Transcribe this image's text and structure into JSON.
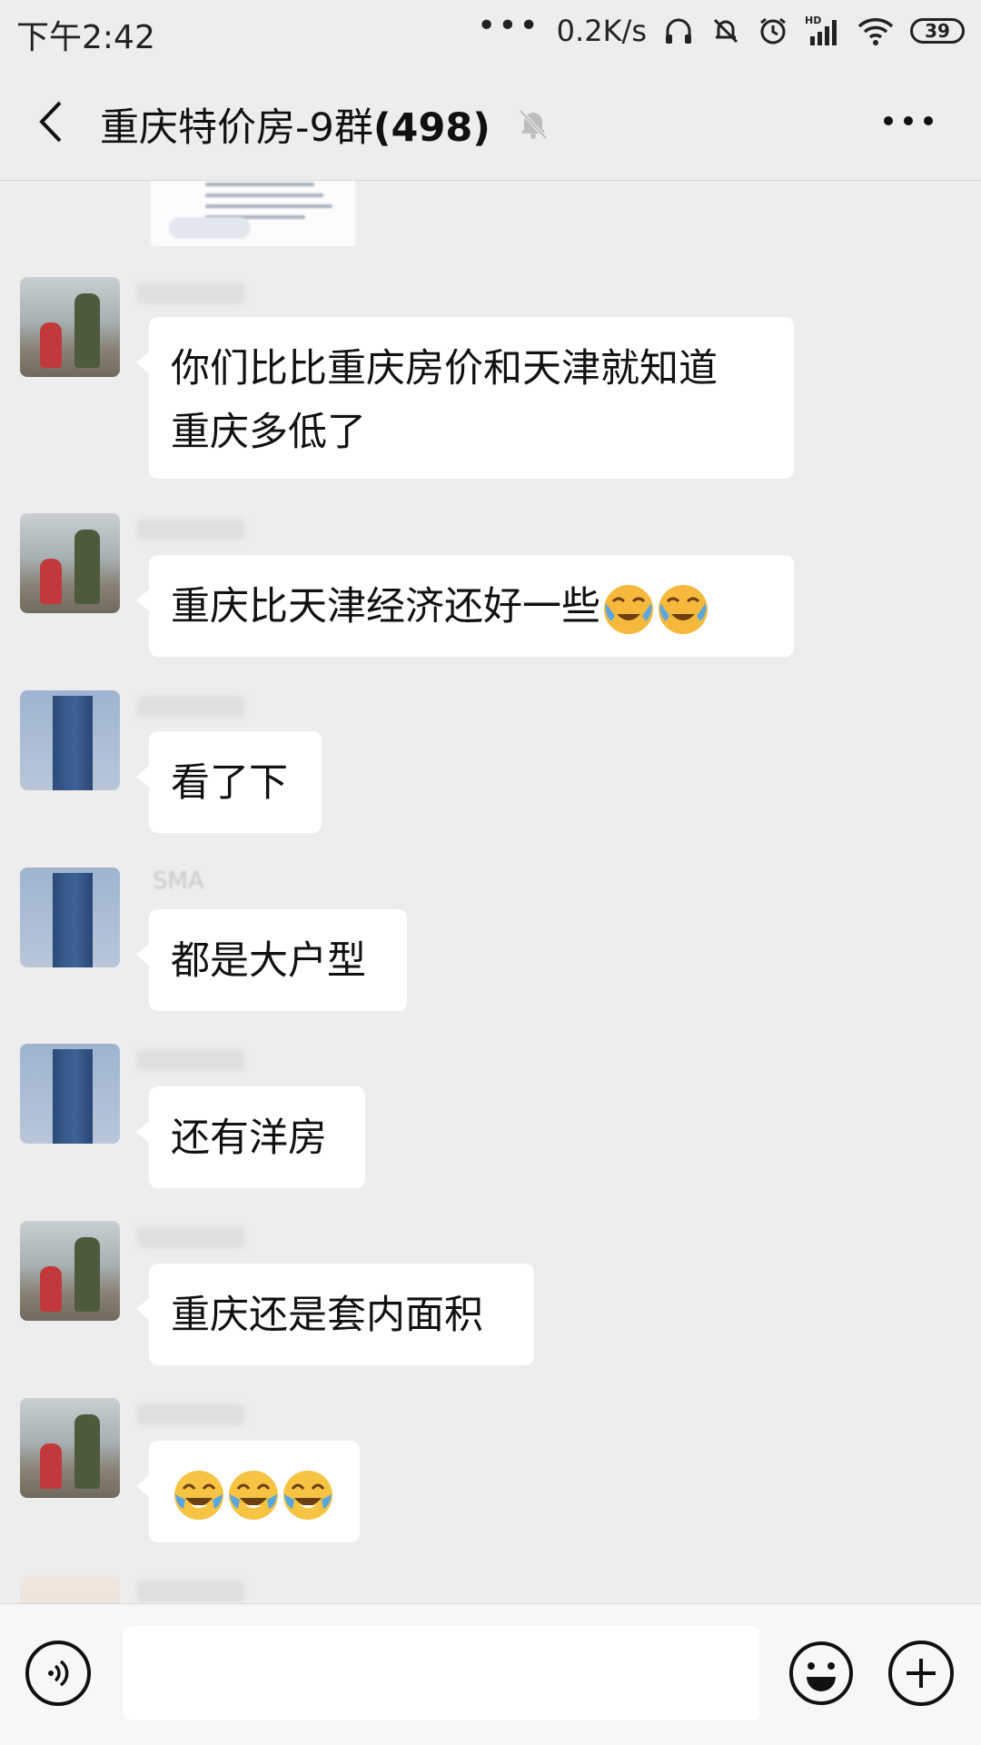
{
  "status_bar": {
    "time": "下午2:42",
    "dots": "•••",
    "network_speed": "0.2K/s",
    "signal_label": "HD",
    "battery": "39",
    "icons": [
      "headphones-icon",
      "mute-icon",
      "alarm-icon",
      "signal-icon",
      "wifi-icon",
      "battery-icon"
    ]
  },
  "header": {
    "title": "重庆特价房-9群",
    "member_count": "(498)",
    "icons": [
      "back-icon",
      "mute-bell-icon",
      "more-icon"
    ]
  },
  "messages": [
    {
      "avatar": "people",
      "nickname": "",
      "text_lines": [
        "你们比比重庆房价和天津就知道",
        "重庆多低了"
      ]
    },
    {
      "avatar": "people",
      "nickname": "",
      "text": "重庆比天津经济还好一些",
      "emojis": [
        "face-with-tears-icon",
        "face-with-tears-icon"
      ]
    },
    {
      "avatar": "building",
      "nickname": "",
      "text": "看了下"
    },
    {
      "avatar": "building",
      "nickname": "SMA",
      "text": "都是大户型"
    },
    {
      "avatar": "building",
      "nickname": "",
      "text": "还有洋房"
    },
    {
      "avatar": "people",
      "nickname": "",
      "text": "重庆还是套内面积"
    },
    {
      "avatar": "people",
      "nickname": "",
      "emojis": [
        "tears-of-joy-icon",
        "tears-of-joy-icon",
        "tears-of-joy-icon"
      ]
    }
  ],
  "input_bar": {
    "placeholder": "",
    "icons": [
      "voice-icon",
      "emoji-icon",
      "plus-icon"
    ]
  },
  "colors": {
    "background": "#ededed",
    "bubble": "#ffffff",
    "text": "#111111"
  }
}
